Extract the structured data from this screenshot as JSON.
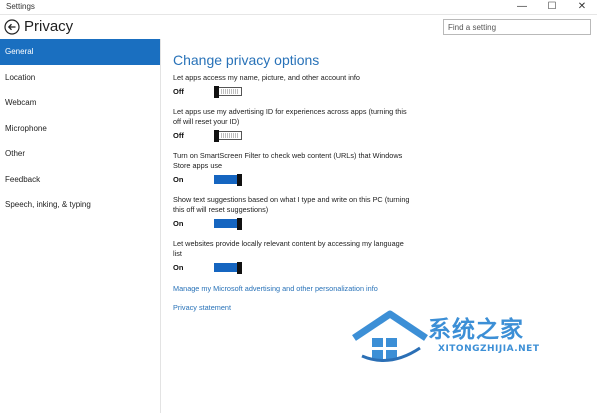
{
  "window": {
    "app_title": "Settings",
    "minimize_glyph": "—",
    "maximize_glyph": "☐",
    "close_glyph": "✕"
  },
  "header": {
    "title": "Privacy",
    "back_icon": "back-arrow-icon",
    "search_placeholder": "Find a setting"
  },
  "sidebar": {
    "items": [
      {
        "label": "General",
        "active": true
      },
      {
        "label": "Location",
        "active": false
      },
      {
        "label": "Webcam",
        "active": false
      },
      {
        "label": "Microphone",
        "active": false
      },
      {
        "label": "Other",
        "active": false
      },
      {
        "label": "Feedback",
        "active": false
      },
      {
        "label": "Speech, inking, & typing",
        "active": false
      }
    ]
  },
  "main": {
    "heading": "Change privacy options",
    "settings": [
      {
        "label": "Let apps access my name, picture, and other account info",
        "state": "Off",
        "on": false
      },
      {
        "label": "Let apps use my advertising ID for experiences across apps (turning this off will reset your ID)",
        "state": "Off",
        "on": false
      },
      {
        "label": "Turn on SmartScreen Filter to check web content (URLs) that Windows Store apps use",
        "state": "On",
        "on": true
      },
      {
        "label": "Show text suggestions based on what I type and write on this PC (turning this off will reset suggestions)",
        "state": "On",
        "on": true
      },
      {
        "label": "Let websites provide locally relevant content by accessing my language list",
        "state": "On",
        "on": true
      }
    ],
    "links": {
      "manage": "Manage my Microsoft advertising and other personalization info",
      "privacy_statement": "Privacy statement"
    }
  },
  "watermark": {
    "chinese": "系统之家",
    "english": "XITONGZHIJIA.NET"
  },
  "colors": {
    "accent": "#1a6fc0",
    "link": "#2872b8",
    "toggle_on": "#1565c0",
    "watermark": "#3c8fd6"
  }
}
